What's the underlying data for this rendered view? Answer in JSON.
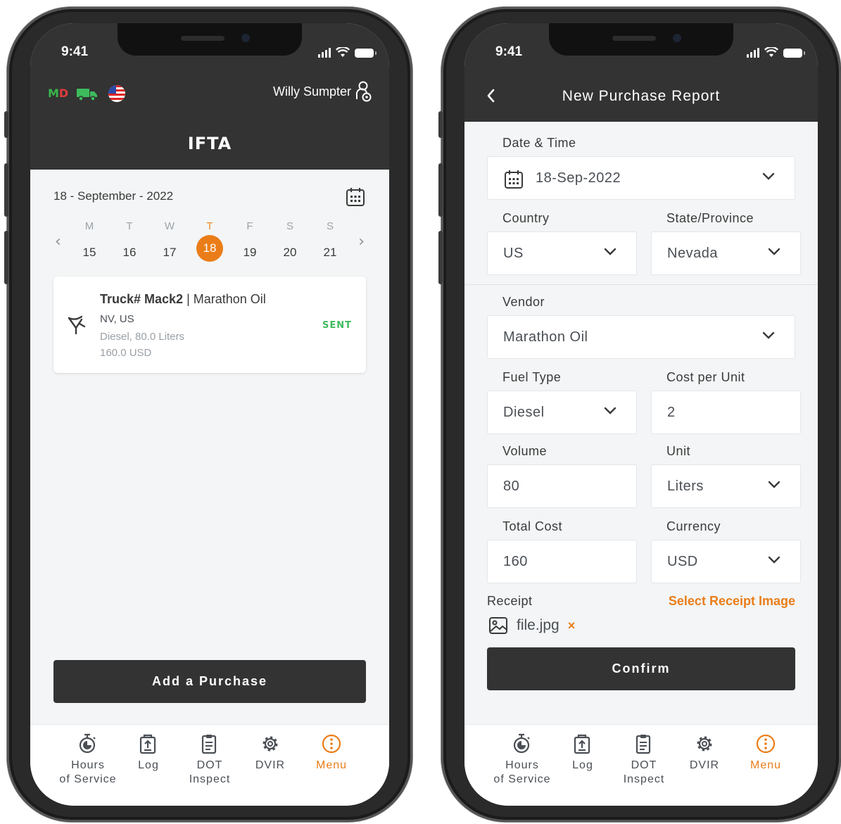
{
  "status_bar": {
    "time": "9:41"
  },
  "left_screen": {
    "status_codes": {
      "m": "M",
      "d": "D"
    },
    "user_name": "Willy Sumpter",
    "title": "IFTA",
    "date_line": "18 - September - 2022",
    "week_days": [
      {
        "letter": "M",
        "num": "15"
      },
      {
        "letter": "T",
        "num": "16"
      },
      {
        "letter": "W",
        "num": "17"
      },
      {
        "letter": "T",
        "num": "18",
        "active": true
      },
      {
        "letter": "F",
        "num": "19"
      },
      {
        "letter": "S",
        "num": "20"
      },
      {
        "letter": "S",
        "num": "21"
      }
    ],
    "purchase_card": {
      "truck_label": "Truck# Mack2",
      "separator": " | ",
      "vendor": "Marathon Oil",
      "location": "NV, US",
      "fuel": "Diesel, 80.0 Liters",
      "cost": "160.0 USD",
      "status": "SENT"
    },
    "add_button": "Add a Purchase"
  },
  "right_screen": {
    "title": "New Purchase Report",
    "labels": {
      "date_time": "Date & Time",
      "country": "Country",
      "state": "State/Province",
      "vendor": "Vendor",
      "fuel_type": "Fuel Type",
      "cost_per_unit": "Cost per Unit",
      "volume": "Volume",
      "unit": "Unit",
      "total_cost": "Total Cost",
      "currency": "Currency",
      "receipt": "Receipt"
    },
    "values": {
      "date_time": "18-Sep-2022",
      "country": "US",
      "state": "Nevada",
      "vendor": "Marathon Oil",
      "fuel_type": "Diesel",
      "cost_per_unit": "2",
      "volume": "80",
      "unit": "Liters",
      "total_cost": "160",
      "currency": "USD"
    },
    "select_receipt": "Select Receipt Image",
    "file_name": "file.jpg",
    "remove_glyph": "×",
    "confirm_button": "Confirm"
  },
  "tabs": [
    {
      "line1": "Hours",
      "line2": "of Service",
      "icon": "stopwatch-icon"
    },
    {
      "line1": "Log",
      "line2": "",
      "icon": "log-icon"
    },
    {
      "line1": "DOT",
      "line2": "Inspect",
      "icon": "clipboard-icon"
    },
    {
      "line1": "DVIR",
      "line2": "",
      "icon": "gear-icon"
    },
    {
      "line1": "Menu",
      "line2": "",
      "icon": "menu-icon",
      "active": true
    }
  ],
  "colors": {
    "accent": "#ea7d18",
    "header": "#333333",
    "sent": "#3dbb5c",
    "background": "#f3f5f6"
  }
}
